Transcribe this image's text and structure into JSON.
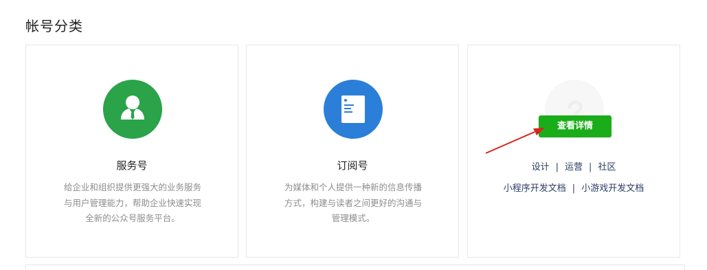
{
  "section": {
    "title": "帐号分类"
  },
  "cards": [
    {
      "name": "服务号",
      "icon": "service-account-person-icon",
      "color": "#2aa349",
      "description": [
        "给企业和组织提供更强大的业务服务",
        "与用户管理能力，帮助企业快速实现",
        "全新的公众号服务平台。"
      ]
    },
    {
      "name": "订阅号",
      "icon": "subscription-document-icon",
      "color": "#2b7fd8",
      "description": [
        "为媒体和个人提供一种新的信息传播",
        "方式，构建与读者之间更好的沟通与",
        "管理模式。"
      ]
    },
    {
      "icon": "mini-program-icon",
      "detail_button": "查看详情",
      "button_color": "#1aad19",
      "links_row1": {
        "design": "设计",
        "operation": "运营",
        "community": "社区"
      },
      "links_row2": {
        "mini_program_docs": "小程序开发文档",
        "mini_game_docs": "小游戏开发文档"
      }
    }
  ],
  "annotation": {
    "arrow_color": "#d9241b"
  }
}
